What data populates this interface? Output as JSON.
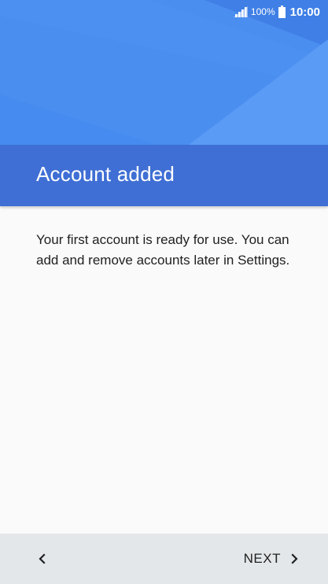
{
  "status_bar": {
    "battery_percent": "100%",
    "time": "10:00",
    "icons": [
      "signal-icon",
      "battery-icon"
    ]
  },
  "header": {
    "title": "Account added"
  },
  "content": {
    "message": "Your first account is ready for use. You can add and remove accounts later in Settings."
  },
  "navigation": {
    "back_icon": "chevron-left-icon",
    "next_label": "NEXT",
    "next_icon": "chevron-right-icon"
  },
  "colors": {
    "hero_blue": "#4a8ef0",
    "title_band_blue": "#3f6fd4",
    "nav_bar_gray": "#e4e7ea",
    "body_background": "#fafafa"
  }
}
